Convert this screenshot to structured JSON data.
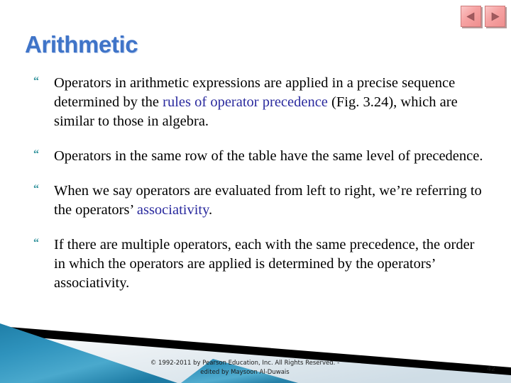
{
  "slide": {
    "title": "Arithmetic",
    "number": "42",
    "accent_color": "#3f74c8",
    "bullet_color": "#36959e",
    "link_color": "#2a2a9e",
    "band_color": "#2f8fb6"
  },
  "nav": {
    "previous_label": "previous-slide",
    "next_label": "next-slide"
  },
  "bullets": [
    {
      "marker": "“",
      "segments": [
        {
          "text": "Operators in arithmetic expressions are applied in a precise sequence determined by the ",
          "style": "normal"
        },
        {
          "text": "rules of operator precedence",
          "style": "link"
        },
        {
          "text": " (Fig. 3.24), which are similar to those in algebra.",
          "style": "normal"
        }
      ]
    },
    {
      "marker": "“",
      "segments": [
        {
          "text": "Operators in the same row of the table have the same level of precedence.",
          "style": "normal"
        }
      ]
    },
    {
      "marker": "“",
      "segments": [
        {
          "text": "When we say operators are evaluated from left to right, we’re referring to the operators’ ",
          "style": "normal"
        },
        {
          "text": "associativity",
          "style": "link"
        },
        {
          "text": ".",
          "style": "normal"
        }
      ]
    },
    {
      "marker": "“",
      "segments": [
        {
          "text": "If there are multiple operators, each with the same precedence, the order in which the operators are applied is determined by the operators’ associativity.",
          "style": "normal"
        }
      ]
    }
  ],
  "footer": {
    "line1": "© 1992-2011 by Pearson Education, Inc. All Rights Reserved. -",
    "line2": "edited by Maysoon Al-Duwais"
  }
}
